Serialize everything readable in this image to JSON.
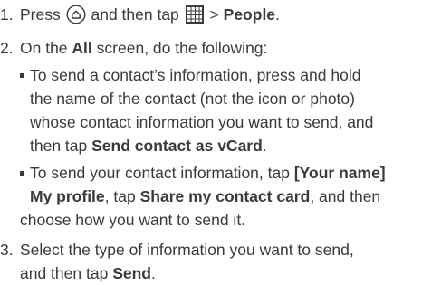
{
  "steps": [
    {
      "num": "1.",
      "t1": "Press",
      "t2": "and then tap",
      "t3": ">",
      "b1": "People",
      "t4": "."
    },
    {
      "num": "2.",
      "t1": "On the",
      "b1": "All",
      "t2": "screen, do the following:"
    },
    {
      "num": "3.",
      "t1": "Select the type of information you want to send,",
      "t2": "and then tap",
      "b1": "Send",
      "t3": "."
    }
  ],
  "bullets": [
    {
      "t1": "To send a contact’s information, press and hold",
      "t2": "the name of the contact (not the icon or photo)",
      "t3": "whose contact information you want to send, and",
      "t4": "then tap",
      "b1": "Send contact as vCard",
      "t5": "."
    },
    {
      "t1": "To send your contact information, tap",
      "b1": "[Your name]",
      "b2": "My profile",
      "t2": ", tap",
      "b3": "Share my contact card",
      "t3": ", and then",
      "t4": "choose how you want to send it."
    }
  ],
  "icons": {
    "home": "home-button-icon",
    "grid": "all-apps-grid-icon"
  },
  "colors": {
    "text": "#3a3a3a",
    "grid_icon": "#3a3a3a"
  }
}
